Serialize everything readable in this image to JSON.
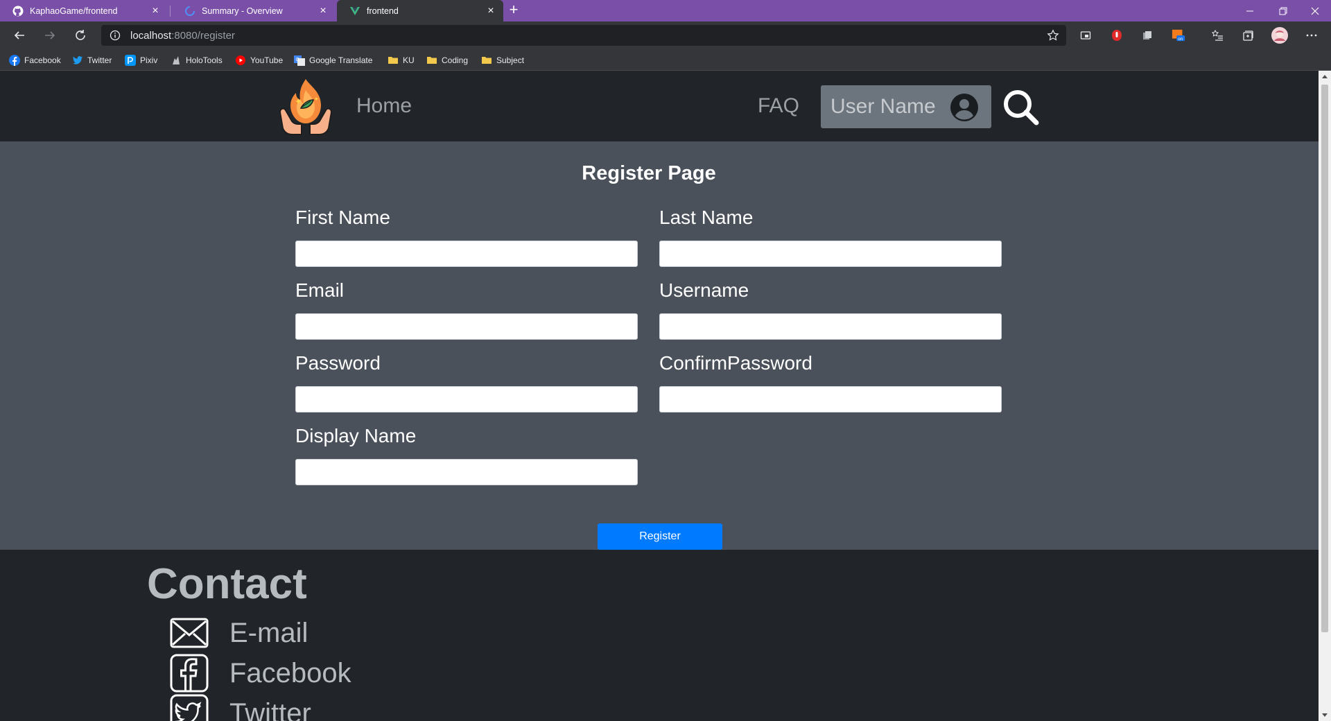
{
  "browser": {
    "tabs": [
      {
        "title": "KaphaoGame/frontend",
        "icon": "github-icon"
      },
      {
        "title": "Summary - Overview",
        "icon": "loading-icon"
      },
      {
        "title": "frontend",
        "icon": "vue-icon",
        "active": true
      }
    ],
    "address": {
      "host": "localhost",
      "path": ":8080/register"
    },
    "bookmarks": [
      {
        "label": "Facebook",
        "icon": "facebook-icon"
      },
      {
        "label": "Twitter",
        "icon": "twitter-icon"
      },
      {
        "label": "Pixiv",
        "icon": "pixiv-icon"
      },
      {
        "label": "HoloTools",
        "icon": "holotools-icon"
      },
      {
        "label": "YouTube",
        "icon": "youtube-icon"
      },
      {
        "label": "Google Translate",
        "icon": "google-translate-icon"
      },
      {
        "label": "KU",
        "icon": "folder-icon"
      },
      {
        "label": "Coding",
        "icon": "folder-icon"
      },
      {
        "label": "Subject",
        "icon": "folder-icon"
      }
    ]
  },
  "nav": {
    "home": "Home",
    "faq": "FAQ",
    "user_name": "User Name"
  },
  "form": {
    "title": "Register Page",
    "fields": {
      "first_name": {
        "label": "First Name",
        "value": ""
      },
      "last_name": {
        "label": "Last Name",
        "value": ""
      },
      "email": {
        "label": "Email",
        "value": ""
      },
      "username": {
        "label": "Username",
        "value": ""
      },
      "password": {
        "label": "Password",
        "value": ""
      },
      "confirm_password": {
        "label": "ConfirmPassword",
        "value": ""
      },
      "display_name": {
        "label": "Display Name",
        "value": ""
      }
    },
    "submit_label": "Register"
  },
  "footer": {
    "title": "Contact",
    "items": [
      {
        "label": "E-mail",
        "icon": "envelope-icon"
      },
      {
        "label": "Facebook",
        "icon": "facebook-icon"
      },
      {
        "label": "Twitter",
        "icon": "twitter-icon"
      }
    ]
  },
  "colors": {
    "tab_bar": "#7a4fa8",
    "nav_bg": "#212529",
    "page_bg": "#4a515a",
    "primary_button": "#007bff"
  }
}
